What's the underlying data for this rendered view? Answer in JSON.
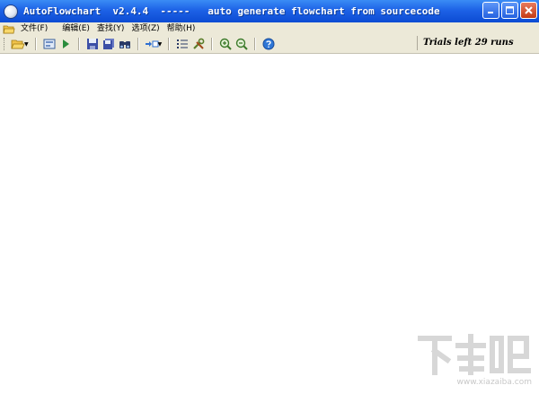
{
  "window": {
    "title": "AutoFlowchart  v2.4.4  -----   auto generate flowchart from sourcecode"
  },
  "menu": {
    "items": [
      "文件(F)",
      "编辑(E)",
      "查找(Y)",
      "选项(Z)",
      "帮助(H)"
    ]
  },
  "toolbar": {
    "icons": [
      "open-folder-icon",
      "flowchart-icon",
      "run-icon",
      "save-icon",
      "save-all-icon",
      "find-icon",
      "goto-icon",
      "list-icon",
      "tools-icon",
      "zoom-in-icon",
      "zoom-out-icon",
      "help-icon"
    ],
    "trials_text": "Trials left 29 runs"
  },
  "watermark": {
    "logo_text": "下载吧",
    "url": "www.xiazaiba.com"
  },
  "colors": {
    "titlebar": "#1d62e6",
    "chrome": "#ece9d8",
    "canvas": "#ffffff"
  }
}
